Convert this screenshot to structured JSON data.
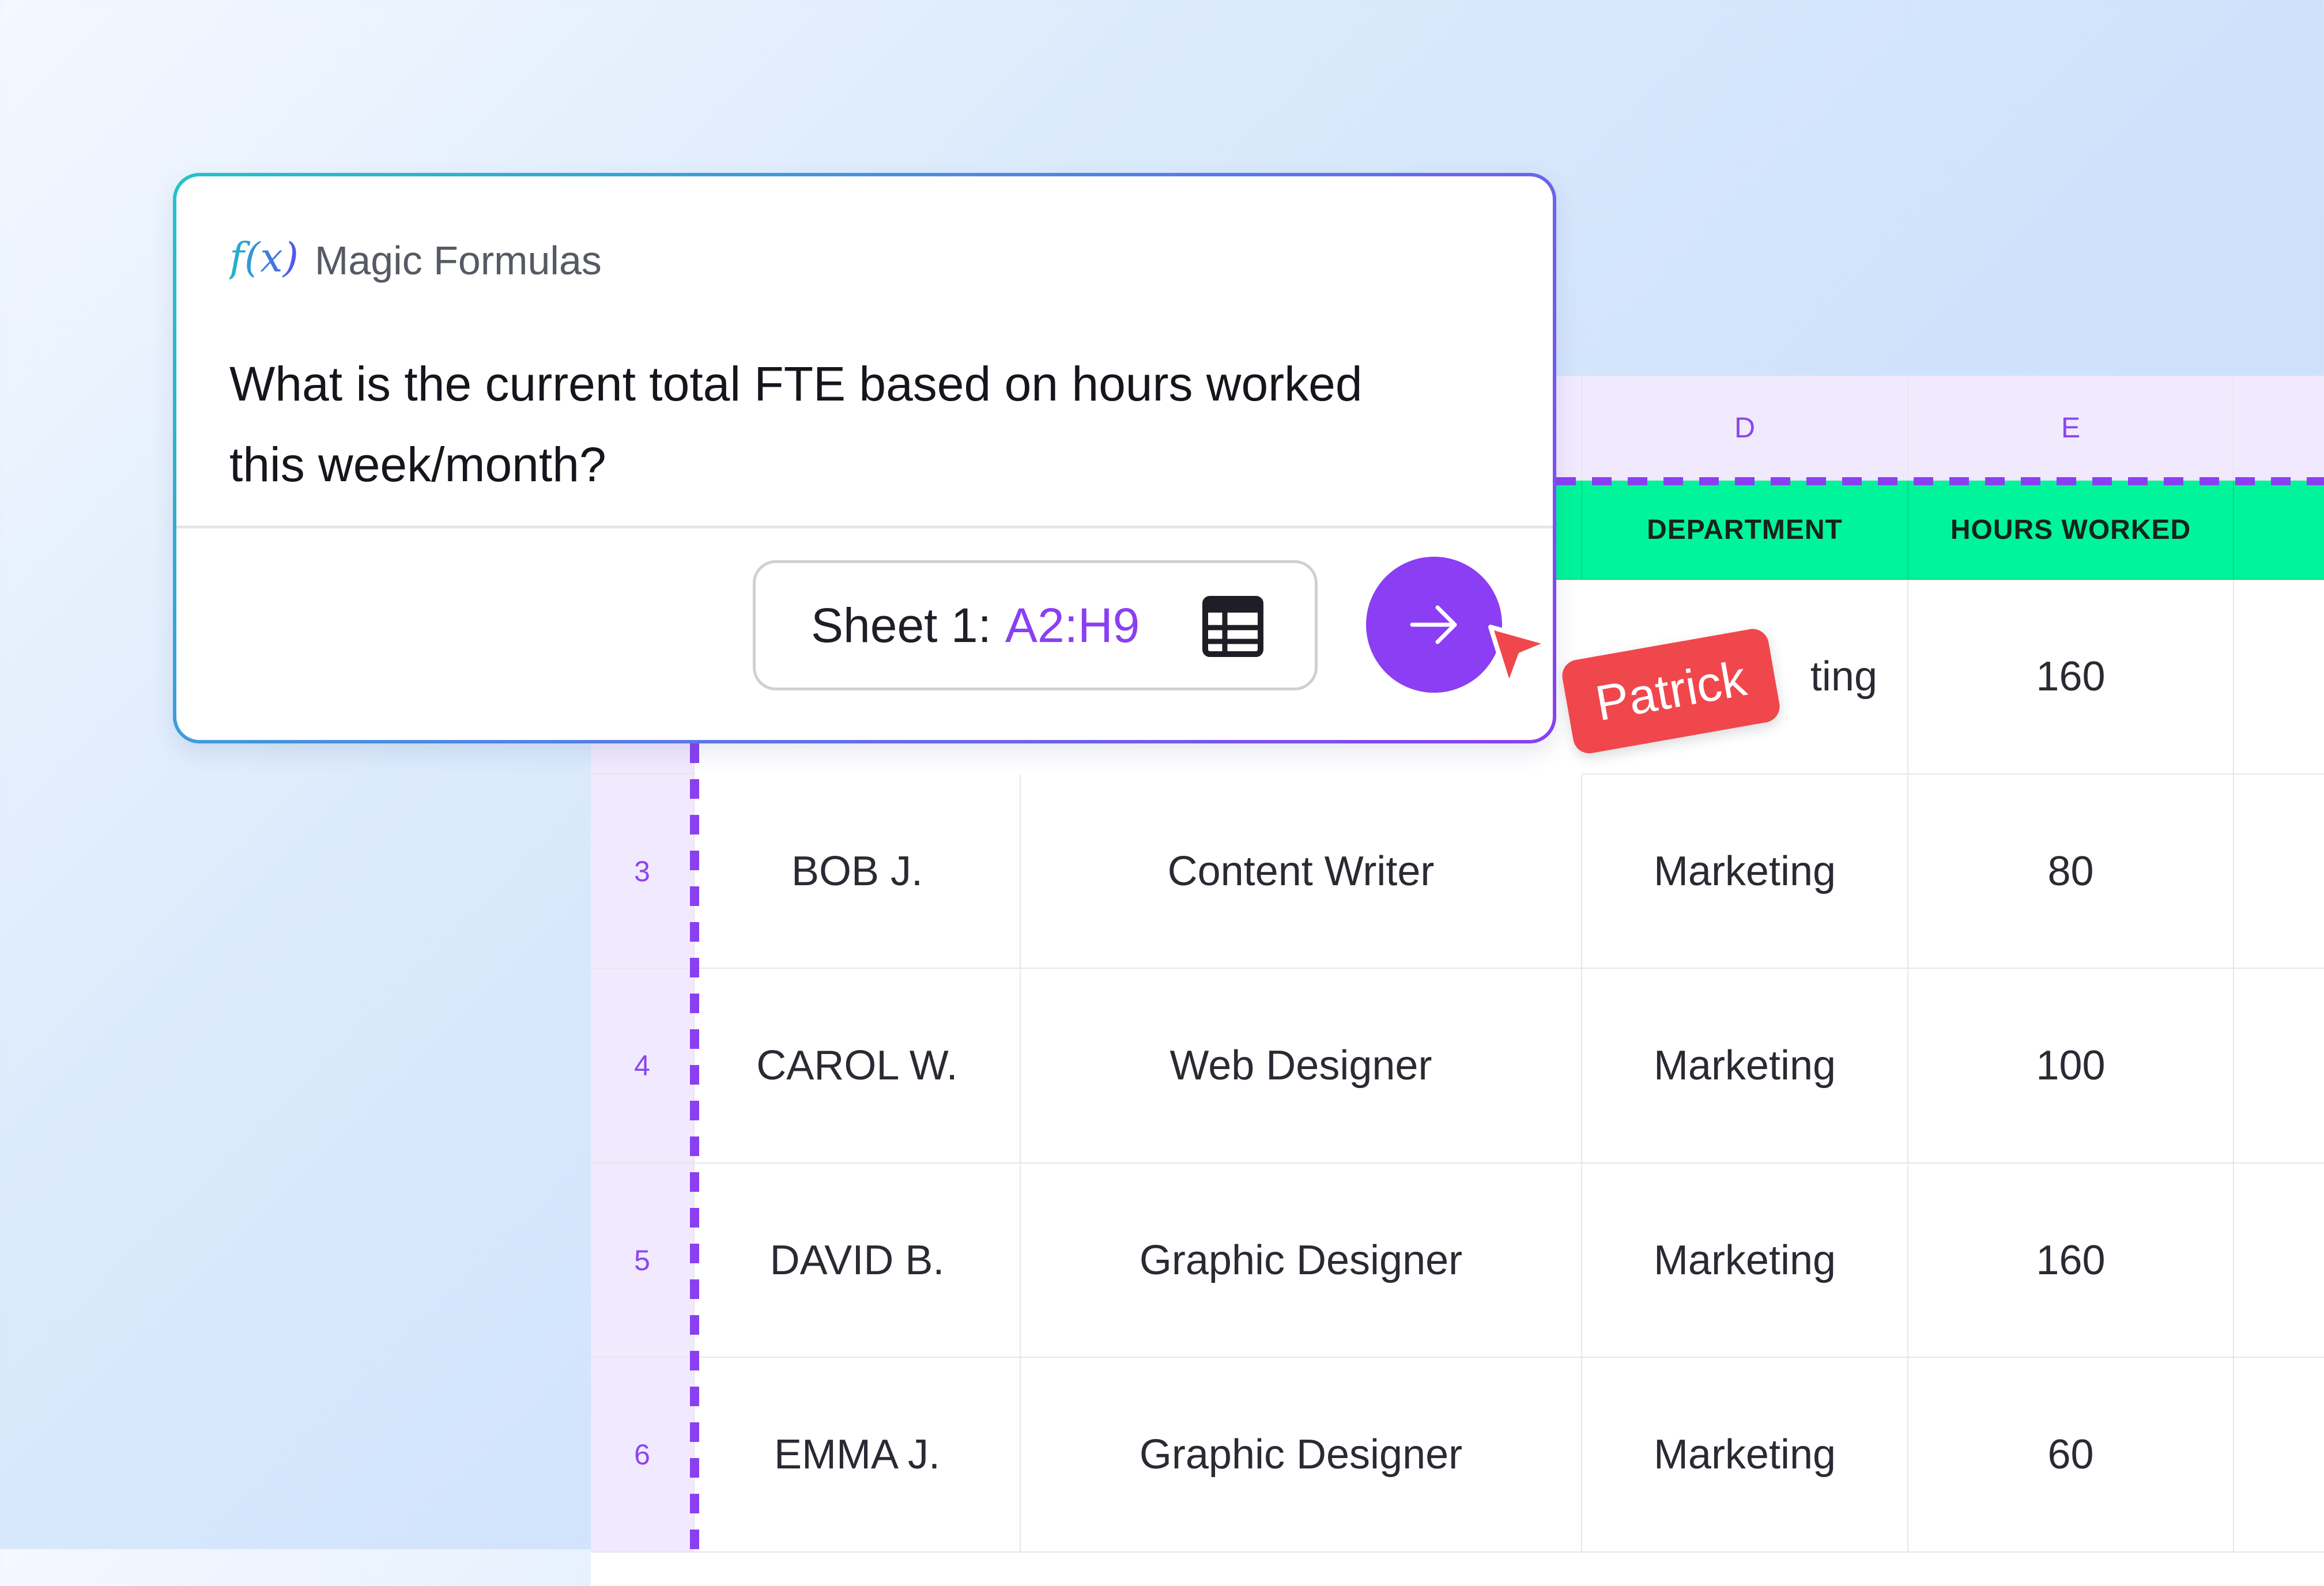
{
  "card": {
    "icon": "f(x)",
    "title": "Magic Formulas",
    "question": "What is the current total FTE based on hours worked this week/month?",
    "range_prefix": "Sheet 1:",
    "range_value": "A2:H9",
    "range_icon": "table-grid-icon",
    "send_icon": "arrow-right-icon"
  },
  "sheet": {
    "columns": [
      "D",
      "E"
    ],
    "headers": [
      "DEPARTMENT",
      "HOURS WORKED"
    ],
    "row2_partial": {
      "department": "ting",
      "hours": "160"
    },
    "rows": [
      {
        "num": "3",
        "name": "BOB J.",
        "role": "Content Writer",
        "department": "Marketing",
        "hours": "80"
      },
      {
        "num": "4",
        "name": "CAROL W.",
        "role": "Web Designer",
        "department": "Marketing",
        "hours": "100"
      },
      {
        "num": "5",
        "name": "DAVID B.",
        "role": "Graphic Designer",
        "department": "Marketing",
        "hours": "160"
      },
      {
        "num": "6",
        "name": "EMMA J.",
        "role": "Graphic Designer",
        "department": "Marketing",
        "hours": "60"
      }
    ]
  },
  "cursor": {
    "user": "Patrick"
  },
  "colors": {
    "accent": "#8b3ef4",
    "header_green": "#00f59a",
    "cursor_red": "#f0474d",
    "header_purple": "#f1e9fe"
  }
}
